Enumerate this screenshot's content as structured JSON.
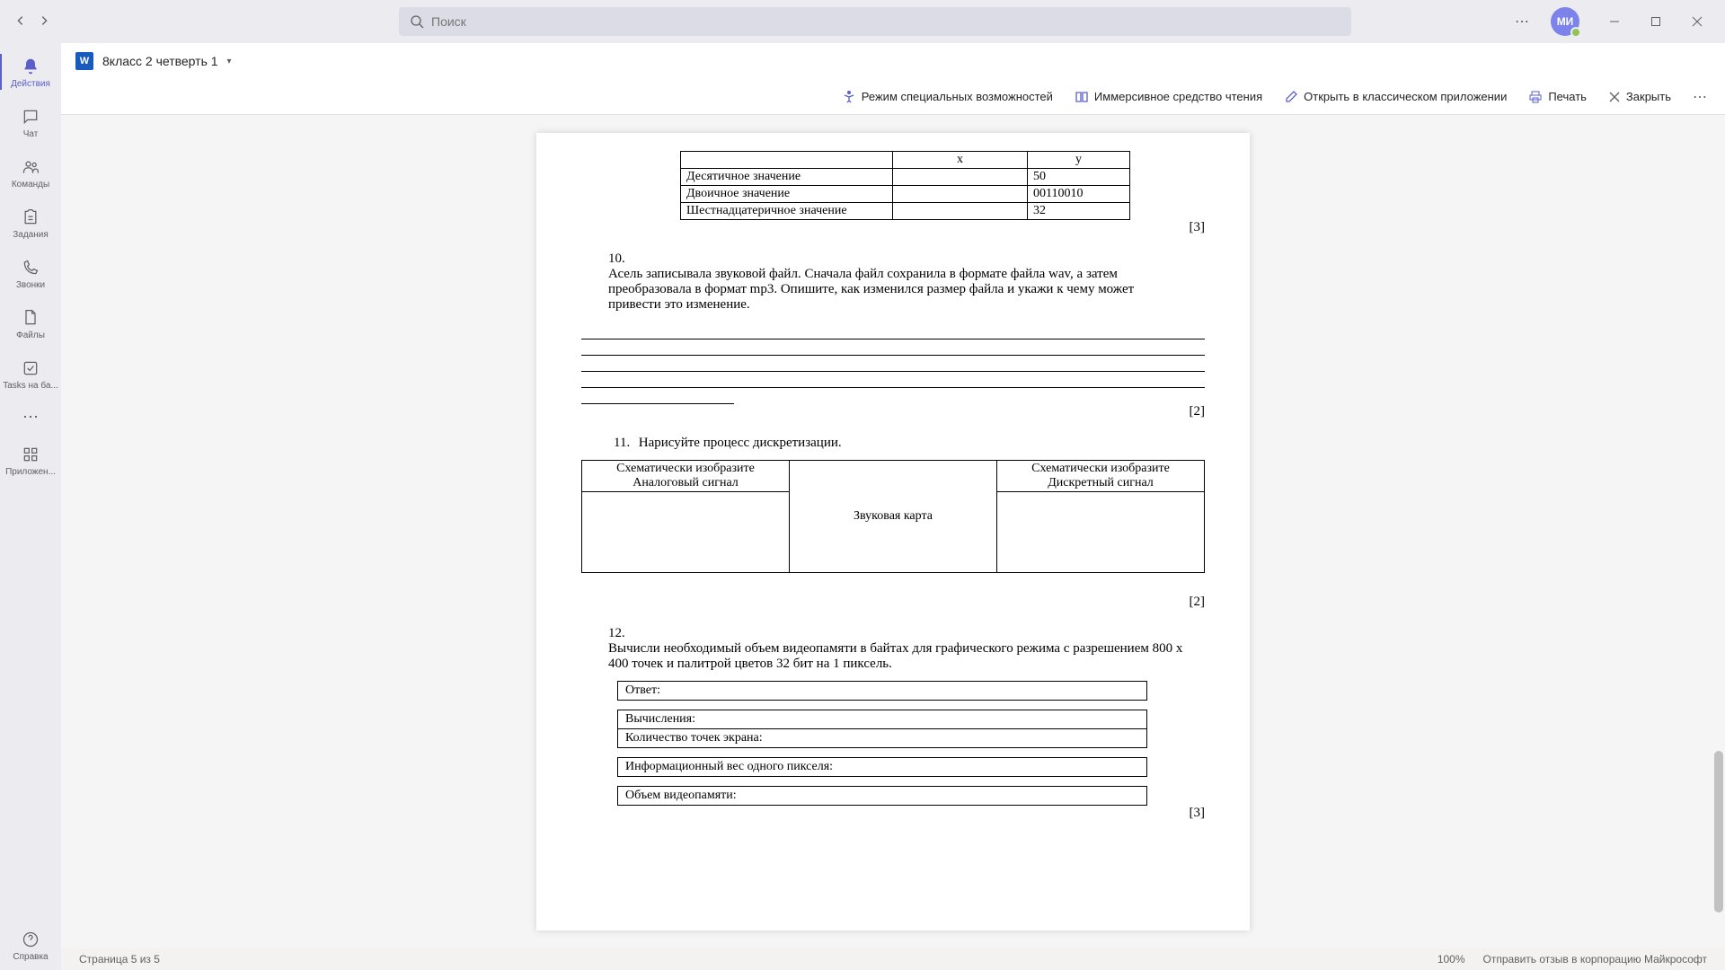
{
  "titlebar": {
    "search_placeholder": "Поиск",
    "avatar_initials": "МИ"
  },
  "rail": {
    "activity": "Действия",
    "chat": "Чат",
    "teams": "Команды",
    "assignments": "Задания",
    "calls": "Звонки",
    "files": "Файлы",
    "tasks": "Tasks на ба...",
    "apps": "Приложен...",
    "help": "Справка"
  },
  "doc": {
    "title": "8класс 2 четверть 1"
  },
  "toolbar": {
    "accessibility": "Режим специальных возможностей",
    "immersive": "Иммерсивное средство чтения",
    "open_desktop": "Открыть в классическом приложении",
    "print": "Печать",
    "close": "Закрыть"
  },
  "content": {
    "t1": {
      "h_x": "x",
      "h_y": "y",
      "r1_label": "Десятичное значение",
      "r1_y": "50",
      "r2_label": "Двоичное значение",
      "r2_y": "00110010",
      "r3_label": "Шестнадцатеричное значение",
      "r3_y": "32"
    },
    "score1": "[3]",
    "q10_num": "10.",
    "q10_text": "Асель записывала звуковой файл. Сначала файл сохранила в формате файла wav, а затем преобразовала в формат mp3. Опишите, как изменился размер файла и укажи к чему может привести это изменение.",
    "score2": "[2]",
    "q11_num": "11.",
    "q11_text": "Нарисуйте процесс дискретизации.",
    "t2": {
      "h1a": "Схематически изобразите",
      "h1b": "Аналоговый сигнал",
      "h2": "Звуковая карта",
      "h3a": "Схематически изобразите",
      "h3b": "Дискретный сигнал"
    },
    "score3": "[2]",
    "q12_num": "12.",
    "q12_text": "Вычисли необходимый объем видеопамяти в байтах для графического режима с разрешением 800 х 400 точек и палитрой цветов 32 бит на 1 пиксель.",
    "ans": {
      "answer": "Ответ:",
      "calc": "Вычисления:",
      "points": "Количество точек экрана:",
      "weight": "Информационный вес одного пикселя:",
      "memory": "Объем видеопамяти:"
    },
    "score4": "[3]"
  },
  "statusbar": {
    "page": "Страница 5 из 5",
    "zoom": "100%",
    "feedback": "Отправить отзыв в корпорацию Майкрософт"
  }
}
